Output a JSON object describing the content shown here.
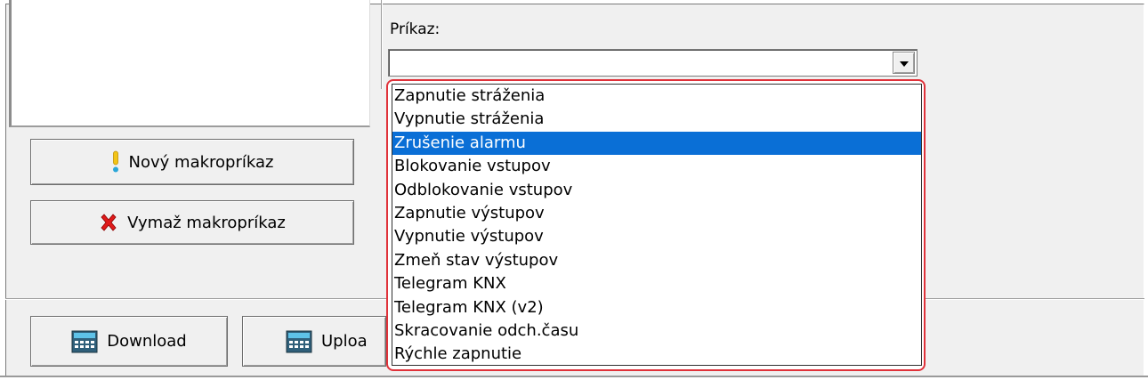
{
  "command_label": "Príkaz:",
  "combo_value": "",
  "buttons": {
    "new_macro": "Nový makropríkaz",
    "delete_macro": "Vymaž makropríkaz",
    "download": "Download",
    "upload": "Uploa"
  },
  "icons": {
    "new_macro": "exclamation-icon",
    "delete_macro": "red-x-icon",
    "download": "computer-transfer-icon",
    "upload": "computer-transfer-icon",
    "combo": "chevron-down-icon"
  },
  "colors": {
    "selection": "#0a6fd6",
    "highlight_border": "#e0323a"
  },
  "dropdown_items": [
    "Zapnutie stráženia",
    "Vypnutie stráženia",
    "Zrušenie alarmu",
    "Blokovanie vstupov",
    "Odblokovanie vstupov",
    "Zapnutie výstupov",
    "Vypnutie výstupov",
    "Zmeň stav výstupov",
    "Telegram KNX",
    "Telegram KNX (v2)",
    "Skracovanie odch.času",
    "Rýchle zapnutie"
  ],
  "selected_index": 2
}
